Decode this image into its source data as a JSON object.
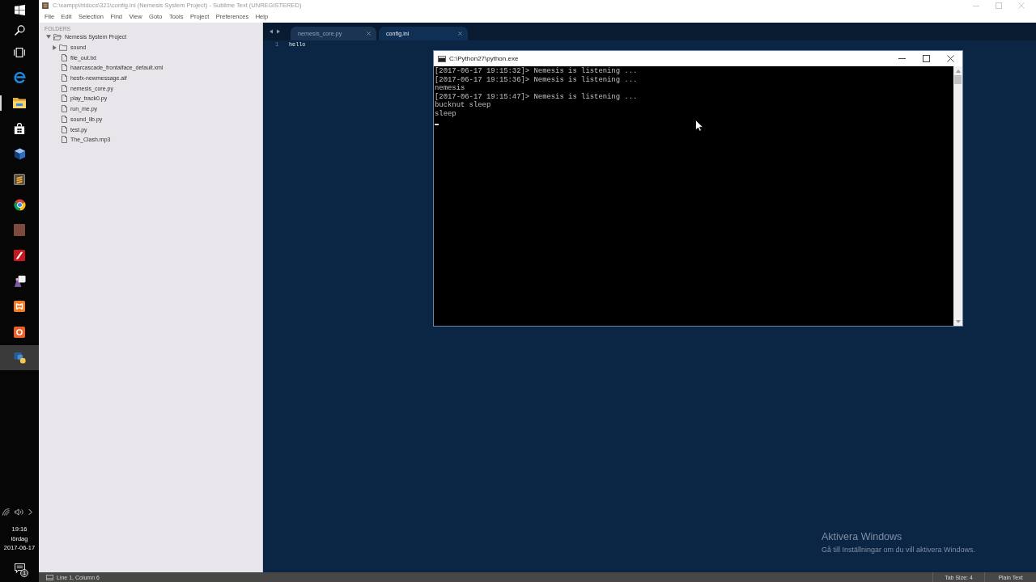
{
  "taskbar": {
    "buttons": [
      {
        "kind": "windows",
        "selected": false,
        "running": false
      },
      {
        "kind": "search",
        "selected": false,
        "running": false
      },
      {
        "kind": "taskview",
        "selected": false,
        "running": false
      },
      {
        "kind": "e",
        "selected": false,
        "running": false
      },
      {
        "kind": "folder",
        "selected": false,
        "running": true
      },
      {
        "kind": "bag",
        "selected": false,
        "running": false
      },
      {
        "kind": "cube",
        "selected": false,
        "running": false
      },
      {
        "kind": "stripes",
        "selected": false,
        "running": false
      },
      {
        "kind": "wheel",
        "selected": false,
        "running": false
      },
      {
        "kind": "photo",
        "selected": false,
        "running": false
      },
      {
        "kind": "slash",
        "selected": false,
        "running": false
      },
      {
        "kind": "shapes",
        "selected": false,
        "running": false
      },
      {
        "kind": "x",
        "selected": false,
        "running": false
      },
      {
        "kind": "ring",
        "selected": false,
        "running": false
      },
      {
        "kind": "snakes",
        "selected": true,
        "running": false
      }
    ],
    "clock": {
      "time": "19:16",
      "day": "lördag",
      "date": "2017-06-17"
    },
    "notification_count": "1"
  },
  "editor_window": {
    "title": "C:\\xampp\\htdocs\\321\\config.ini (Nemesis System Project) - Sublime Text (UNREGISTERED)",
    "menu": [
      "File",
      "Edit",
      "Selection",
      "Find",
      "View",
      "Goto",
      "Tools",
      "Project",
      "Preferences",
      "Help"
    ],
    "sidebar": {
      "heading": "FOLDERS",
      "tree": [
        {
          "name": "Nemesis System Project",
          "kind": "folder",
          "expanded": true,
          "children": [
            {
              "name": "sound",
              "kind": "folder",
              "expanded": false
            },
            {
              "name": "file_out.txt",
              "kind": "file"
            },
            {
              "name": "haarcascade_frontalface_default.xml",
              "kind": "file"
            },
            {
              "name": "hesfx-newmessage.aif",
              "kind": "file"
            },
            {
              "name": "nemesis_core.py",
              "kind": "file"
            },
            {
              "name": "play_track0.py",
              "kind": "file"
            },
            {
              "name": "run_me.py",
              "kind": "file"
            },
            {
              "name": "sound_lib.py",
              "kind": "file"
            },
            {
              "name": "test.py",
              "kind": "file"
            },
            {
              "name": "The_Clash.mp3",
              "kind": "file"
            }
          ]
        }
      ]
    },
    "tabs": [
      {
        "label": "nemesis_core.py",
        "selected": false
      },
      {
        "label": "config.ini",
        "selected": true
      }
    ],
    "lines": [
      {
        "number": "1",
        "text": "hello"
      }
    ],
    "status_bar": {
      "position": "Line 1, Column 6",
      "tab_size": "Tab Size: 4",
      "syntax": "Plain Text"
    }
  },
  "console_window": {
    "title": "C:\\Python27\\python.exe",
    "lines": [
      "[2017-06-17 19:15:32]> Nemesis is listening ...",
      "[2017-06-17 19:15:36]> Nemesis is listening ...",
      "nemesis",
      "[2017-06-17 19:15:47]> Nemesis is listening ...",
      "bucknut sleep",
      "sleep"
    ]
  },
  "activation_notice": {
    "title": "Aktivera Windows",
    "text": "Gå till Inställningar om du vill aktivera Windows."
  }
}
